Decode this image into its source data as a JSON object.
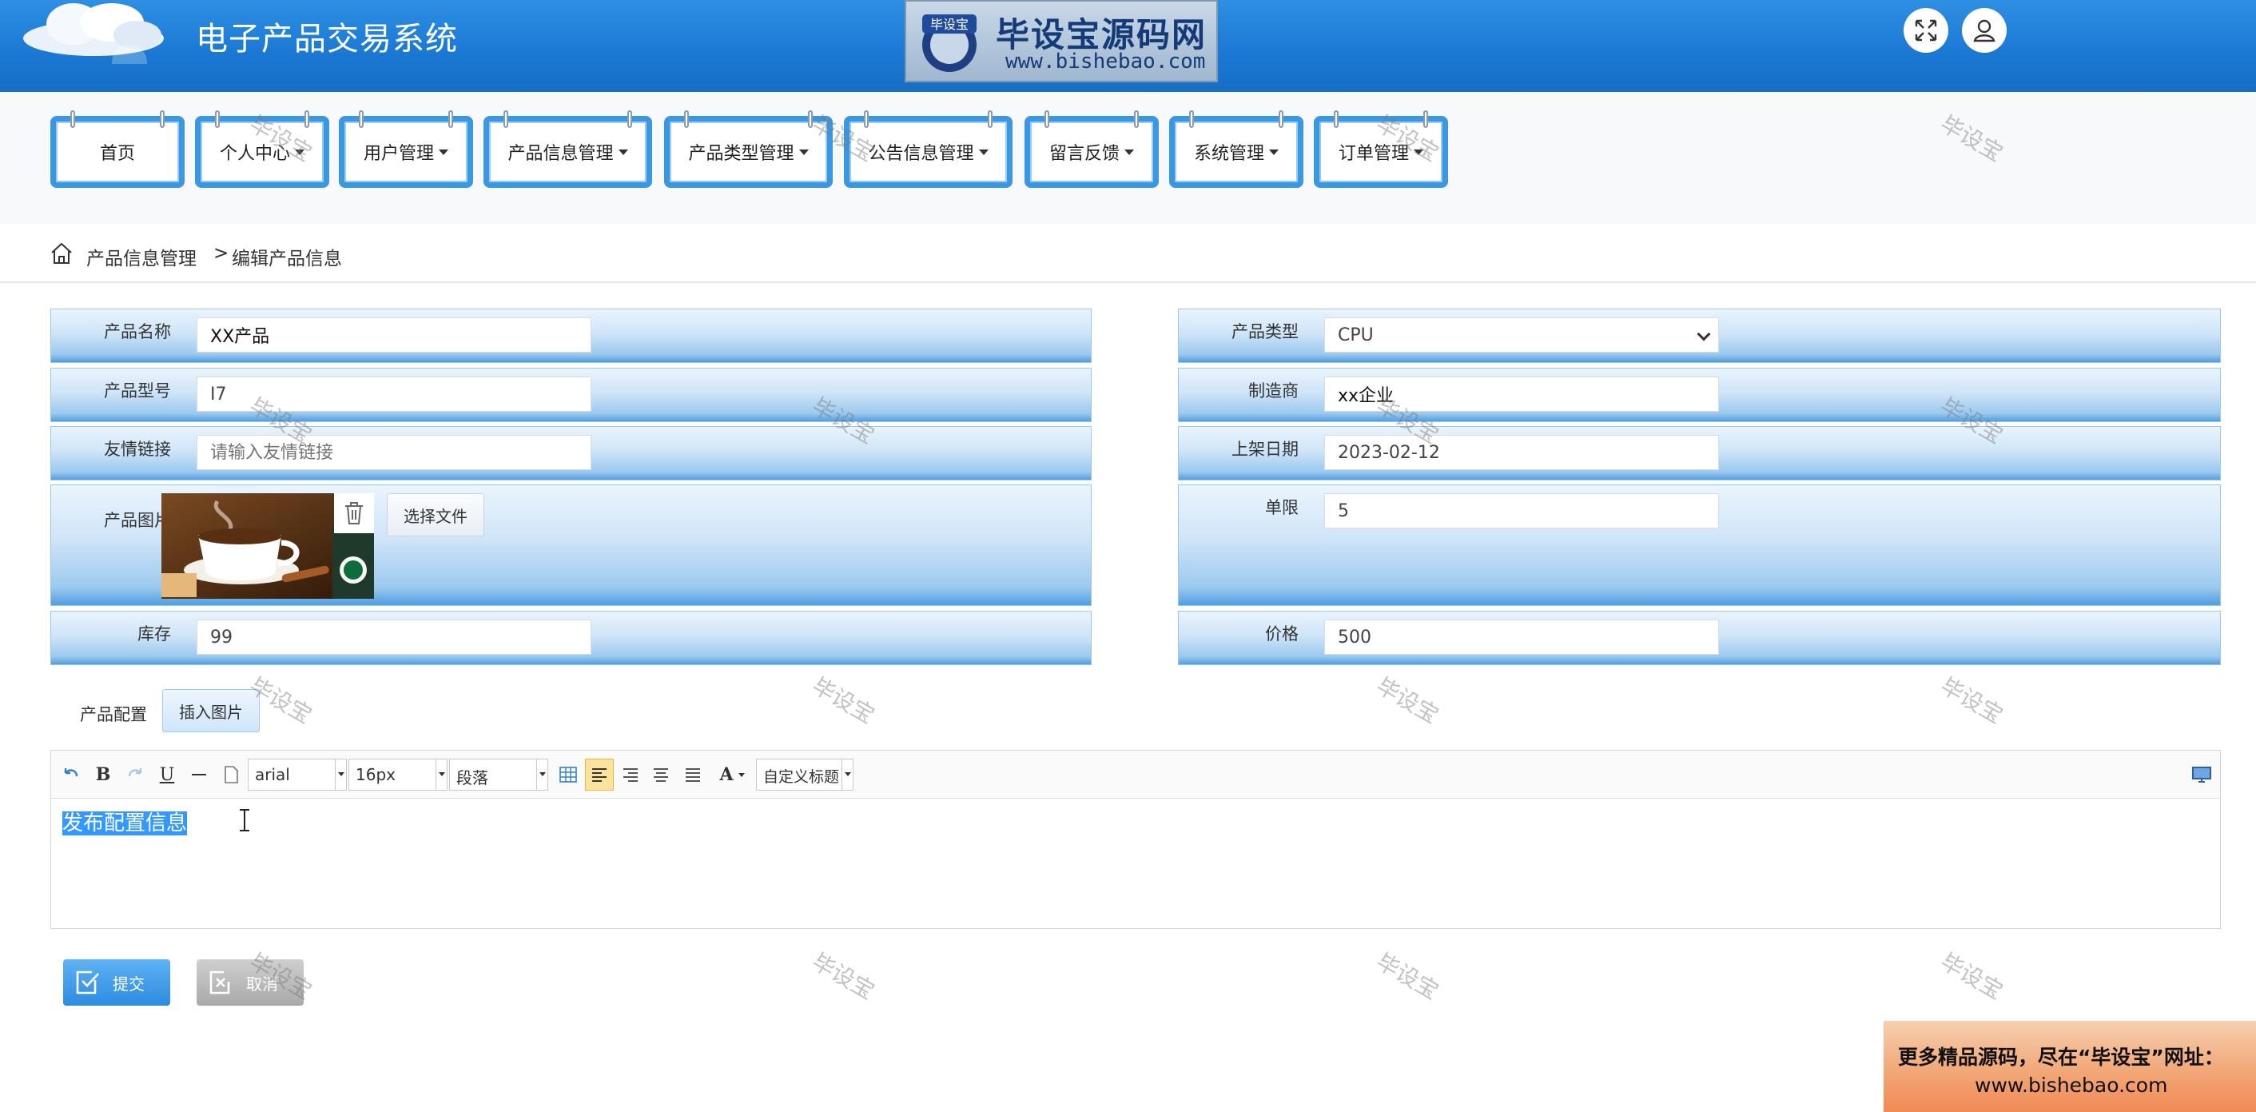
{
  "header": {
    "title": "电子产品交易系统",
    "logo_name": "毕设宝源码网",
    "logo_badge": "毕设宝",
    "logo_url": "www.bishebao.com",
    "fullscreen_icon": "expand-icon",
    "user_icon": "user-icon"
  },
  "nav": [
    {
      "label": "首页",
      "dropdown": false
    },
    {
      "label": "个人中心",
      "dropdown": true
    },
    {
      "label": "用户管理",
      "dropdown": true
    },
    {
      "label": "产品信息管理",
      "dropdown": true
    },
    {
      "label": "产品类型管理",
      "dropdown": true
    },
    {
      "label": "公告信息管理",
      "dropdown": true
    },
    {
      "label": "留言反馈",
      "dropdown": true
    },
    {
      "label": "系统管理",
      "dropdown": true
    },
    {
      "label": "订单管理",
      "dropdown": true
    }
  ],
  "breadcrumb": {
    "section": "产品信息管理",
    "separator": ">",
    "page": "编辑产品信息"
  },
  "form": {
    "name": {
      "label": "产品名称",
      "value": "XX产品"
    },
    "model": {
      "label": "产品型号",
      "value": "I7"
    },
    "link": {
      "label": "友情链接",
      "placeholder": "请输入友情链接"
    },
    "image": {
      "label": "产品图片",
      "choose_label": "选择文件"
    },
    "stock": {
      "label": "库存",
      "value": "99"
    },
    "type": {
      "label": "产品类型",
      "value": "CPU"
    },
    "maker": {
      "label": "制造商",
      "value": "xx企业"
    },
    "date": {
      "label": "上架日期",
      "value": "2023-02-12"
    },
    "limit": {
      "label": "单限",
      "value": "5"
    },
    "price": {
      "label": "价格",
      "value": "500"
    }
  },
  "config": {
    "label": "产品配置",
    "insert_label": "插入图片",
    "toolbar": {
      "bold": "B",
      "underline": "U",
      "font": "arial",
      "size": "16px",
      "paragraph": "段落",
      "font_color": "A",
      "custom_title": "自定义标题"
    },
    "content": "发布配置信息"
  },
  "actions": {
    "submit": "提交",
    "cancel": "取消"
  },
  "watermark": "毕设宝",
  "ad": {
    "line1": "更多精品源码，尽在“毕设宝”网址：",
    "line2": "www.bishebao.com"
  },
  "colors": {
    "header": "#1a78d3",
    "nav_border": "#3a97e4",
    "submit": "#2d8be0",
    "cancel": "#a9a9a9",
    "selection": "#3399ff"
  }
}
